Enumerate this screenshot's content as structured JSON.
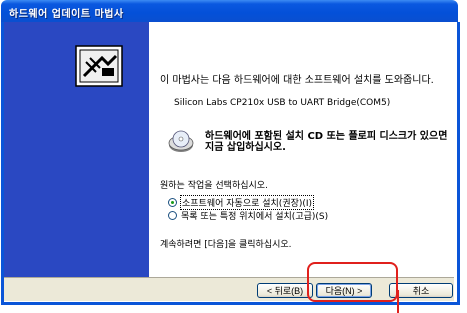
{
  "window": {
    "title": "하드웨어 업데이트 마법사"
  },
  "content": {
    "heading": "이 마법사는 다음 하드웨어에 대한 소프트웨어 설치를 도와줍니다.",
    "device_name": "Silicon Labs CP210x USB to UART Bridge(COM5)",
    "cd_prompt": "하드웨어에 포함된 설치 CD 또는 플로피 디스크가 있으면 지금 삽입하십시오.",
    "task_prompt": "원하는 작업을 선택하십시오.",
    "options": [
      {
        "label": "소프트웨어 자동으로 설치(권장)(I)",
        "selected": true
      },
      {
        "label": "목록 또는 특정 위치에서 설치(고급)(S)",
        "selected": false
      }
    ],
    "continue_text": "계속하려면 [다음]을 클릭하십시오."
  },
  "buttons": {
    "back": "< 뒤로(B)",
    "next": "다음(N) >",
    "cancel": "취소"
  },
  "colors": {
    "annotation": "#e0201c",
    "sidebar": "#2a48c2",
    "titlebar": "#0450d8"
  }
}
